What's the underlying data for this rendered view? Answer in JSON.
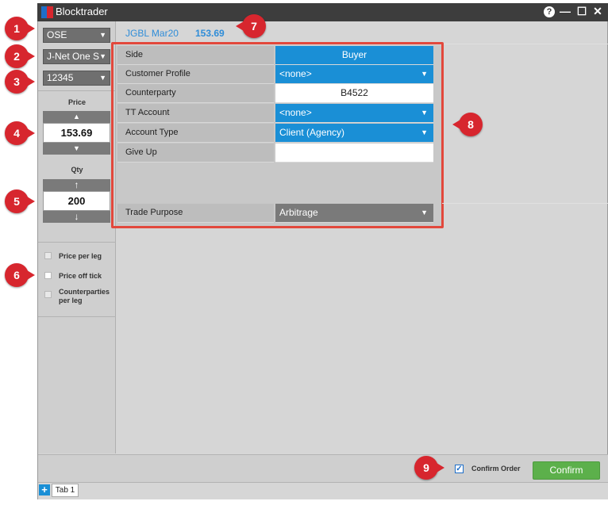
{
  "window": {
    "title": "Blocktrader",
    "help_icon": "?",
    "minimize_icon": "—",
    "maximize_icon": "☐",
    "close_icon": "✕"
  },
  "left": {
    "exchange": "OSE",
    "market": "J-Net One S",
    "account": "12345",
    "price_label": "Price",
    "price_value": "153.69",
    "qty_label": "Qty",
    "qty_value": "200",
    "options": [
      {
        "label": "Price per leg",
        "checked": false
      },
      {
        "label": "Price off tick",
        "checked": false
      },
      {
        "label": "Counterparties per leg",
        "checked": false
      }
    ]
  },
  "header": {
    "instrument": "JGBL Mar20",
    "price": "153.69"
  },
  "form": {
    "rows": [
      {
        "label": "Side",
        "value": "Buyer"
      },
      {
        "label": "Customer Profile",
        "value": "<none>"
      },
      {
        "label": "Counterparty",
        "value": "B4522"
      },
      {
        "label": "TT Account",
        "value": "<none>"
      },
      {
        "label": "Account Type",
        "value": "Client (Agency)"
      },
      {
        "label": "Give Up",
        "value": ""
      }
    ],
    "trade_purpose_label": "Trade Purpose",
    "trade_purpose_value": "Arbitrage"
  },
  "bottom": {
    "confirm_order_label": "Confirm Order",
    "confirm_order_checked": true,
    "confirm_button": "Confirm"
  },
  "tabs": {
    "add_icon": "+",
    "items": [
      "Tab 1"
    ]
  },
  "callouts": [
    "1",
    "2",
    "3",
    "4",
    "5",
    "6",
    "7",
    "8",
    "9"
  ],
  "colors": {
    "accent_blue": "#1a8fd6",
    "confirm_green": "#5cb04b",
    "callout_red": "#d7262e",
    "titlebar": "#3d3d3d"
  }
}
